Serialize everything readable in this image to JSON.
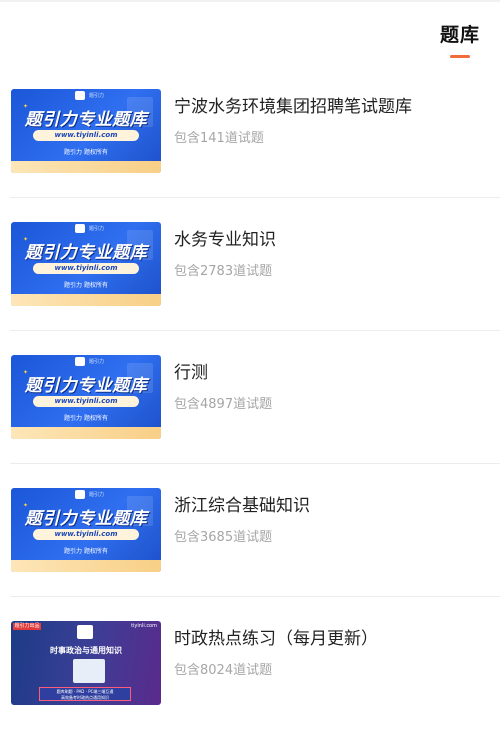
{
  "header": {
    "tab_label": "题库"
  },
  "thumbnail": {
    "logo_text": "题引力",
    "title": "题引力专业题库",
    "url": "www.tiyinli.com",
    "tagline": "题引力 题权所有"
  },
  "special_thumbnail": {
    "badge": "题引力出品",
    "url": "tiyinli.com",
    "title": "时事政治与通用知识",
    "banner_line1": "题库刷题 · PAD · PC端三端互通",
    "banner_line2": "高效备考时政热点通用知识"
  },
  "banks": [
    {
      "name": "宁波水务环境集团招聘笔试题库",
      "count": "包含141道试题",
      "thumb": "blue"
    },
    {
      "name": "水务专业知识",
      "count": "包含2783道试题",
      "thumb": "blue"
    },
    {
      "name": "行测",
      "count": "包含4897道试题",
      "thumb": "blue"
    },
    {
      "name": "浙江综合基础知识",
      "count": "包含3685道试题",
      "thumb": "blue"
    },
    {
      "name": "时政热点练习（每月更新）",
      "count": "包含8024道试题",
      "thumb": "purple"
    }
  ],
  "colors": {
    "accent": "#f26b3a",
    "thumb_blue": "#1b57d8",
    "bottom_band": "#f8cf86"
  }
}
